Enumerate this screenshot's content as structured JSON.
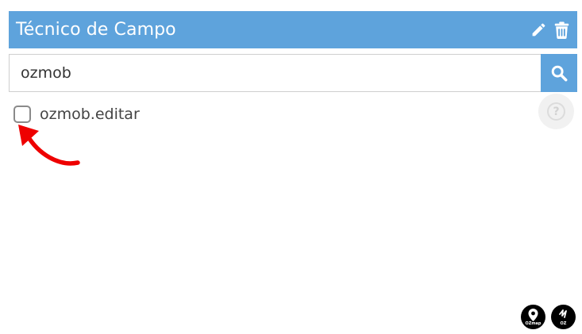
{
  "header": {
    "title": "Técnico de Campo",
    "background": "#5ea3dc",
    "edit_icon": "pencil-icon",
    "delete_icon": "trash-icon"
  },
  "search": {
    "value": "ozmob",
    "button_icon": "search-icon",
    "button_background": "#5ea3dc"
  },
  "permissions": [
    {
      "label": "ozmob.editar",
      "checked": false
    }
  ],
  "help_button": {
    "glyph": "?",
    "icon": "question-circle-icon"
  },
  "annotation": {
    "icon": "curved-arrow-icon",
    "color": "#ee0000"
  },
  "footer_logos": [
    {
      "name": "oz-map-logo",
      "text": "OZmap"
    },
    {
      "name": "oz-sign-logo",
      "text": "OZ"
    }
  ]
}
